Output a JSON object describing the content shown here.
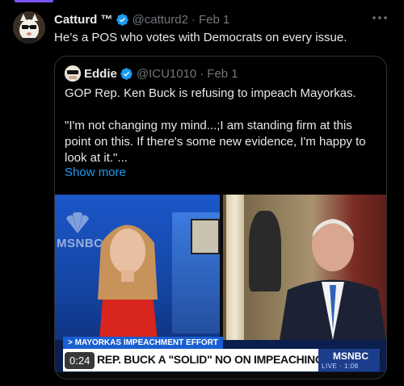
{
  "tweet": {
    "author_name": "Catturd ™",
    "handle": "@catturd2",
    "separator": "·",
    "date": "Feb 1",
    "text": "He’s a POS who votes with Democrats on every issue.",
    "more_icon": "more-horizontal-icon",
    "verified_icon": "verified-badge-icon"
  },
  "quote": {
    "author_name": "Eddie",
    "handle": "@ICU1010",
    "separator": "·",
    "date": "Feb 1",
    "line1": "GOP Rep. Ken Buck is refusing to impeach Mayorkas.",
    "paragraph": "\"I'm not changing my mind...;I am standing firm at this point on this. If there's some new evidence, I'm happy to look at it.\"...",
    "show_more": "Show more"
  },
  "media": {
    "timer": "0:24",
    "tag": "> MAYORKAS IMPEACHMENT EFFORT",
    "chyron": "REP. BUCK A \"SOLID\" NO ON IMPEACHING DHS SECY.",
    "brand": "MSNBC",
    "live": "LIVE · 1:08",
    "background_logo": "MSNBC"
  },
  "colors": {
    "background": "#000000",
    "text": "#e7e9ea",
    "muted": "#71767b",
    "link": "#1d9bf0",
    "border": "#2f3336",
    "verified": "#1d9bf0",
    "accent": "#7856ff"
  }
}
